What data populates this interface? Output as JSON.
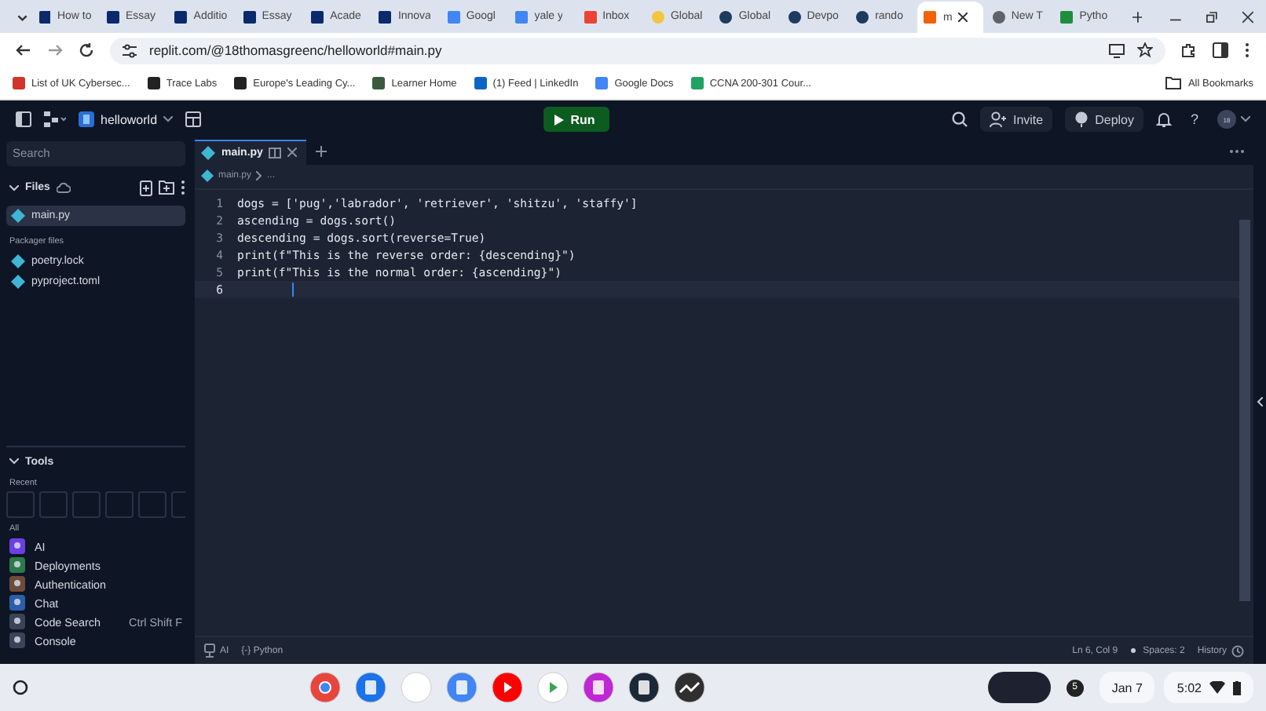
{
  "browser": {
    "tabs": [
      {
        "title": "How to",
        "kind": "y",
        "selected": false
      },
      {
        "title": "Essay",
        "kind": "y",
        "selected": false
      },
      {
        "title": "Additio",
        "kind": "y",
        "selected": false
      },
      {
        "title": "Essay",
        "kind": "y",
        "selected": false
      },
      {
        "title": "Acade",
        "kind": "y",
        "selected": false
      },
      {
        "title": "Innova",
        "kind": "y",
        "selected": false
      },
      {
        "title": "Googl",
        "kind": "doc",
        "selected": false
      },
      {
        "title": "yale y",
        "kind": "doc",
        "selected": false
      },
      {
        "title": "Inbox",
        "kind": "mail",
        "selected": false
      },
      {
        "title": "Global",
        "kind": "bulb",
        "selected": false
      },
      {
        "title": "Global",
        "kind": "dot",
        "selected": false
      },
      {
        "title": "Devpo",
        "kind": "dot",
        "selected": false
      },
      {
        "title": "rando",
        "kind": "dot",
        "selected": false
      },
      {
        "title": "m",
        "kind": "replit",
        "selected": true
      },
      {
        "title": "New T",
        "kind": "globe",
        "selected": false
      },
      {
        "title": "Pytho",
        "kind": "w",
        "selected": false
      }
    ],
    "url": "replit.com/@18thomasgreenc/helloworld#main.py",
    "bookmarks": [
      {
        "label": "List of UK Cybersec...",
        "kind": "rocket"
      },
      {
        "label": "Trace Labs",
        "kind": "circle"
      },
      {
        "label": "Europe's Leading Cy...",
        "kind": "pin"
      },
      {
        "label": "Learner Home",
        "kind": "cap"
      },
      {
        "label": "(1) Feed | LinkedIn",
        "kind": "linkedin"
      },
      {
        "label": "Google Docs",
        "kind": "doc"
      },
      {
        "label": "CCNA 200-301 Cour...",
        "kind": "drive"
      }
    ],
    "all_bookmarks": "All Bookmarks"
  },
  "topbar": {
    "project": "helloworld",
    "run": "Run",
    "invite": "Invite",
    "deploy": "Deploy",
    "help": "?",
    "avatar": "18"
  },
  "sidebar": {
    "search": {
      "placeholder": "Search"
    },
    "files_title": "Files",
    "files": [
      {
        "name": "main.py",
        "selected": true
      }
    ],
    "packager_title": "Packager files",
    "packager_files": [
      {
        "name": "poetry.lock",
        "selected": false
      },
      {
        "name": "pyproject.toml",
        "selected": false
      }
    ],
    "tools_title": "Tools",
    "recent_label": "Recent",
    "all_label": "All",
    "tools": [
      {
        "name": "AI",
        "kind": "ai"
      },
      {
        "name": "Deployments",
        "kind": "deploy"
      },
      {
        "name": "Authentication",
        "kind": "auth"
      },
      {
        "name": "Chat",
        "kind": "chat"
      },
      {
        "name": "Code Search",
        "kind": "search",
        "shortcut": "Ctrl Shift F"
      },
      {
        "name": "Console",
        "kind": "console"
      }
    ]
  },
  "editor": {
    "tab": "main.py",
    "breadcrumb": "main.py",
    "breadcrumb_more": "...",
    "lines": [
      {
        "number": "1",
        "code": "dogs = ['pug','labrador', 'retriever', 'shitzu', 'staffy']",
        "current": false
      },
      {
        "number": "2",
        "code": "ascending = dogs.sort()",
        "current": false
      },
      {
        "number": "3",
        "code": "descending = dogs.sort(reverse=True)",
        "current": false
      },
      {
        "number": "4",
        "code": "print(f\"This is the reverse order: {descending}\")",
        "current": false
      },
      {
        "number": "5",
        "code": "print(f\"This is the normal order: {ascending}\")",
        "current": false
      },
      {
        "number": "6",
        "current": true
      }
    ]
  },
  "status_bar": {
    "ai": "AI",
    "language": "{-} Python",
    "position": "Ln 6, Col 9",
    "spaces": "Spaces: 2",
    "history": "History"
  },
  "taskbar": {
    "apps": [
      {
        "kind": "chrome"
      },
      {
        "kind": "files"
      },
      {
        "kind": "gmail"
      },
      {
        "kind": "docs"
      },
      {
        "kind": "youtube"
      },
      {
        "kind": "play"
      },
      {
        "kind": "pink"
      },
      {
        "kind": "steam"
      },
      {
        "kind": "chart"
      }
    ],
    "notifications": "5",
    "date": "Jan 7",
    "time": "5:02"
  }
}
